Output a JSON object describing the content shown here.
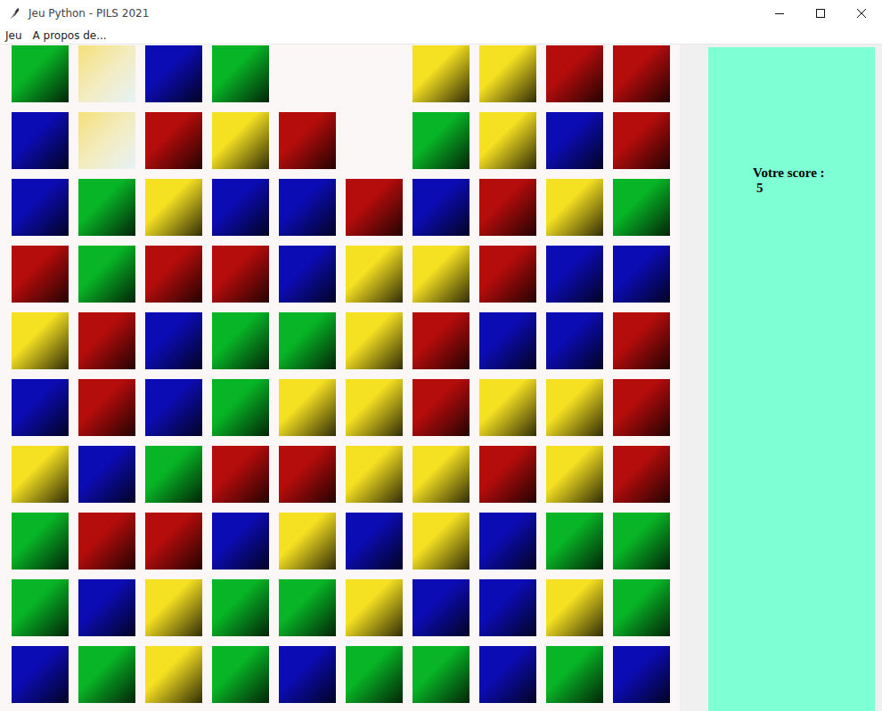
{
  "window": {
    "title": "Jeu Python - PILS 2021"
  },
  "menu": [
    "Jeu",
    "A propos de..."
  ],
  "score": {
    "label": "Votre score :",
    "value": "5"
  },
  "grid": {
    "rows": [
      {
        "cells": [
          {
            "kind": "tile",
            "color": "#08b526"
          },
          {
            "kind": "faded",
            "color": "#f5e07a"
          },
          {
            "kind": "tile",
            "color": "#0c0cb5"
          },
          {
            "kind": "tile",
            "color": "#08b526"
          },
          {
            "kind": "empty"
          },
          {
            "kind": "empty"
          },
          {
            "kind": "tile",
            "color": "#f5e022"
          },
          {
            "kind": "tile",
            "color": "#f5e022"
          },
          {
            "kind": "tile",
            "color": "#b50c0c"
          },
          {
            "kind": "tile",
            "color": "#b50c0c"
          }
        ]
      },
      {
        "cells": [
          {
            "kind": "tile",
            "color": "#0c0cb5"
          },
          {
            "kind": "faded",
            "color": "#f5e07a"
          },
          {
            "kind": "tile",
            "color": "#b50c0c"
          },
          {
            "kind": "tile",
            "color": "#f5e022"
          },
          {
            "kind": "tile",
            "color": "#b50c0c"
          },
          {
            "kind": "empty"
          },
          {
            "kind": "tile",
            "color": "#08b526"
          },
          {
            "kind": "tile",
            "color": "#f5e022"
          },
          {
            "kind": "tile",
            "color": "#0c0cb5"
          },
          {
            "kind": "tile",
            "color": "#b50c0c"
          }
        ]
      },
      {
        "cells": [
          {
            "kind": "tile",
            "color": "#0c0cb5"
          },
          {
            "kind": "tile",
            "color": "#08b526"
          },
          {
            "kind": "tile",
            "color": "#f5e022"
          },
          {
            "kind": "tile",
            "color": "#0c0cb5"
          },
          {
            "kind": "tile",
            "color": "#0c0cb5"
          },
          {
            "kind": "tile",
            "color": "#b50c0c"
          },
          {
            "kind": "tile",
            "color": "#0c0cb5"
          },
          {
            "kind": "tile",
            "color": "#b50c0c"
          },
          {
            "kind": "tile",
            "color": "#f5e022"
          },
          {
            "kind": "tile",
            "color": "#08b526"
          }
        ]
      },
      {
        "cells": [
          {
            "kind": "tile",
            "color": "#b50c0c"
          },
          {
            "kind": "tile",
            "color": "#08b526"
          },
          {
            "kind": "tile",
            "color": "#b50c0c"
          },
          {
            "kind": "tile",
            "color": "#b50c0c"
          },
          {
            "kind": "tile",
            "color": "#0c0cb5"
          },
          {
            "kind": "tile",
            "color": "#f5e022"
          },
          {
            "kind": "tile",
            "color": "#f5e022"
          },
          {
            "kind": "tile",
            "color": "#b50c0c"
          },
          {
            "kind": "tile",
            "color": "#0c0cb5"
          },
          {
            "kind": "tile",
            "color": "#0c0cb5"
          }
        ]
      },
      {
        "cells": [
          {
            "kind": "tile",
            "color": "#f5e022"
          },
          {
            "kind": "tile",
            "color": "#b50c0c"
          },
          {
            "kind": "tile",
            "color": "#0c0cb5"
          },
          {
            "kind": "tile",
            "color": "#08b526"
          },
          {
            "kind": "tile",
            "color": "#08b526"
          },
          {
            "kind": "tile",
            "color": "#f5e022"
          },
          {
            "kind": "tile",
            "color": "#b50c0c"
          },
          {
            "kind": "tile",
            "color": "#0c0cb5"
          },
          {
            "kind": "tile",
            "color": "#0c0cb5"
          },
          {
            "kind": "tile",
            "color": "#b50c0c"
          }
        ]
      },
      {
        "cells": [
          {
            "kind": "tile",
            "color": "#0c0cb5"
          },
          {
            "kind": "tile",
            "color": "#b50c0c"
          },
          {
            "kind": "tile",
            "color": "#0c0cb5"
          },
          {
            "kind": "tile",
            "color": "#08b526"
          },
          {
            "kind": "tile",
            "color": "#f5e022"
          },
          {
            "kind": "tile",
            "color": "#f5e022"
          },
          {
            "kind": "tile",
            "color": "#b50c0c"
          },
          {
            "kind": "tile",
            "color": "#f5e022"
          },
          {
            "kind": "tile",
            "color": "#f5e022"
          },
          {
            "kind": "tile",
            "color": "#b50c0c"
          }
        ]
      },
      {
        "cells": [
          {
            "kind": "tile",
            "color": "#f5e022"
          },
          {
            "kind": "tile",
            "color": "#0c0cb5"
          },
          {
            "kind": "tile",
            "color": "#08b526"
          },
          {
            "kind": "tile",
            "color": "#b50c0c"
          },
          {
            "kind": "tile",
            "color": "#b50c0c"
          },
          {
            "kind": "tile",
            "color": "#f5e022"
          },
          {
            "kind": "tile",
            "color": "#f5e022"
          },
          {
            "kind": "tile",
            "color": "#b50c0c"
          },
          {
            "kind": "tile",
            "color": "#f5e022"
          },
          {
            "kind": "tile",
            "color": "#b50c0c"
          }
        ]
      },
      {
        "cells": [
          {
            "kind": "tile",
            "color": "#08b526"
          },
          {
            "kind": "tile",
            "color": "#b50c0c"
          },
          {
            "kind": "tile",
            "color": "#b50c0c"
          },
          {
            "kind": "tile",
            "color": "#0c0cb5"
          },
          {
            "kind": "tile",
            "color": "#f5e022"
          },
          {
            "kind": "tile",
            "color": "#0c0cb5"
          },
          {
            "kind": "tile",
            "color": "#f5e022"
          },
          {
            "kind": "tile",
            "color": "#0c0cb5"
          },
          {
            "kind": "tile",
            "color": "#08b526"
          },
          {
            "kind": "tile",
            "color": "#08b526"
          }
        ]
      },
      {
        "cells": [
          {
            "kind": "tile",
            "color": "#08b526"
          },
          {
            "kind": "tile",
            "color": "#0c0cb5"
          },
          {
            "kind": "tile",
            "color": "#f5e022"
          },
          {
            "kind": "tile",
            "color": "#08b526"
          },
          {
            "kind": "tile",
            "color": "#08b526"
          },
          {
            "kind": "tile",
            "color": "#f5e022"
          },
          {
            "kind": "tile",
            "color": "#0c0cb5"
          },
          {
            "kind": "tile",
            "color": "#0c0cb5"
          },
          {
            "kind": "tile",
            "color": "#f5e022"
          },
          {
            "kind": "tile",
            "color": "#08b526"
          }
        ]
      },
      {
        "cells": [
          {
            "kind": "tile",
            "color": "#0c0cb5"
          },
          {
            "kind": "tile",
            "color": "#08b526"
          },
          {
            "kind": "tile",
            "color": "#f5e022"
          },
          {
            "kind": "tile",
            "color": "#08b526"
          },
          {
            "kind": "tile",
            "color": "#0c0cb5"
          },
          {
            "kind": "tile",
            "color": "#08b526"
          },
          {
            "kind": "tile",
            "color": "#08b526"
          },
          {
            "kind": "tile",
            "color": "#0c0cb5"
          },
          {
            "kind": "tile",
            "color": "#08b526"
          },
          {
            "kind": "tile",
            "color": "#0c0cb5"
          }
        ]
      }
    ]
  }
}
